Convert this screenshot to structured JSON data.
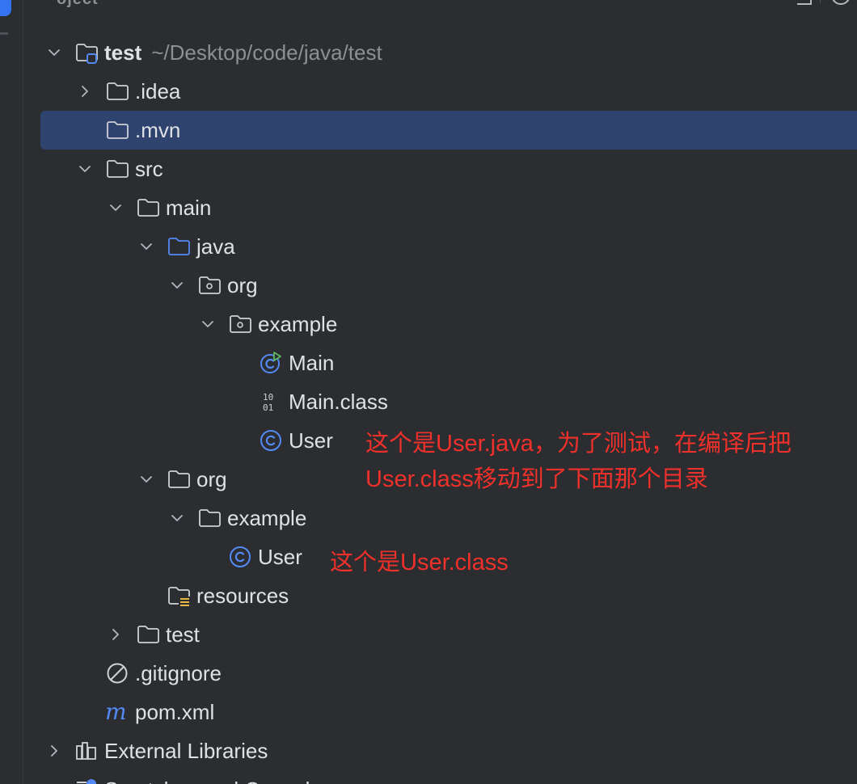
{
  "window": {
    "header_fragment": "oject",
    "accent_color": "#3574f0",
    "selection_color": "#2e436e",
    "background_color": "#2b2d30"
  },
  "tree": {
    "root": {
      "label": "test",
      "path": "~/Desktop/code/java/test",
      "icon": "module-folder-icon",
      "expanded": true
    },
    "idea": {
      "label": ".idea",
      "icon": "folder-icon",
      "expanded": false
    },
    "mvn": {
      "label": ".mvn",
      "icon": "folder-icon",
      "selected": true
    },
    "src": {
      "label": "src",
      "icon": "folder-icon",
      "expanded": true
    },
    "main": {
      "label": "main",
      "icon": "folder-icon",
      "expanded": true
    },
    "java": {
      "label": "java",
      "icon": "source-root-folder-icon",
      "expanded": true
    },
    "org1": {
      "label": "org",
      "icon": "package-icon",
      "expanded": true
    },
    "example1": {
      "label": "example",
      "icon": "package-icon",
      "expanded": true
    },
    "main_class_runnable": {
      "label": "Main",
      "icon": "runnable-class-icon"
    },
    "main_class_binary": {
      "label": "Main.class",
      "icon": "binary-file-icon"
    },
    "user_java": {
      "label": "User",
      "icon": "class-icon"
    },
    "org2": {
      "label": "org",
      "icon": "folder-icon",
      "expanded": true
    },
    "example2": {
      "label": "example",
      "icon": "folder-icon",
      "expanded": true
    },
    "user_class": {
      "label": "User",
      "icon": "class-icon"
    },
    "resources": {
      "label": "resources",
      "icon": "resources-folder-icon"
    },
    "test": {
      "label": "test",
      "icon": "folder-icon",
      "expanded": false
    },
    "gitignore": {
      "label": ".gitignore",
      "icon": "ignore-file-icon"
    },
    "pom": {
      "label": "pom.xml",
      "icon": "maven-icon"
    },
    "external_libraries": {
      "label": "External Libraries",
      "icon": "libraries-icon",
      "expanded": false
    },
    "scratches": {
      "label": "Scratches and Consoles",
      "icon": "scratches-icon"
    }
  },
  "annotations": {
    "note1_line1": "这个是User.java，为了测试，在编译后把",
    "note1_line2": "User.class移动到了下面那个目录",
    "note2": "这个是User.class",
    "color": "#f0302a"
  }
}
